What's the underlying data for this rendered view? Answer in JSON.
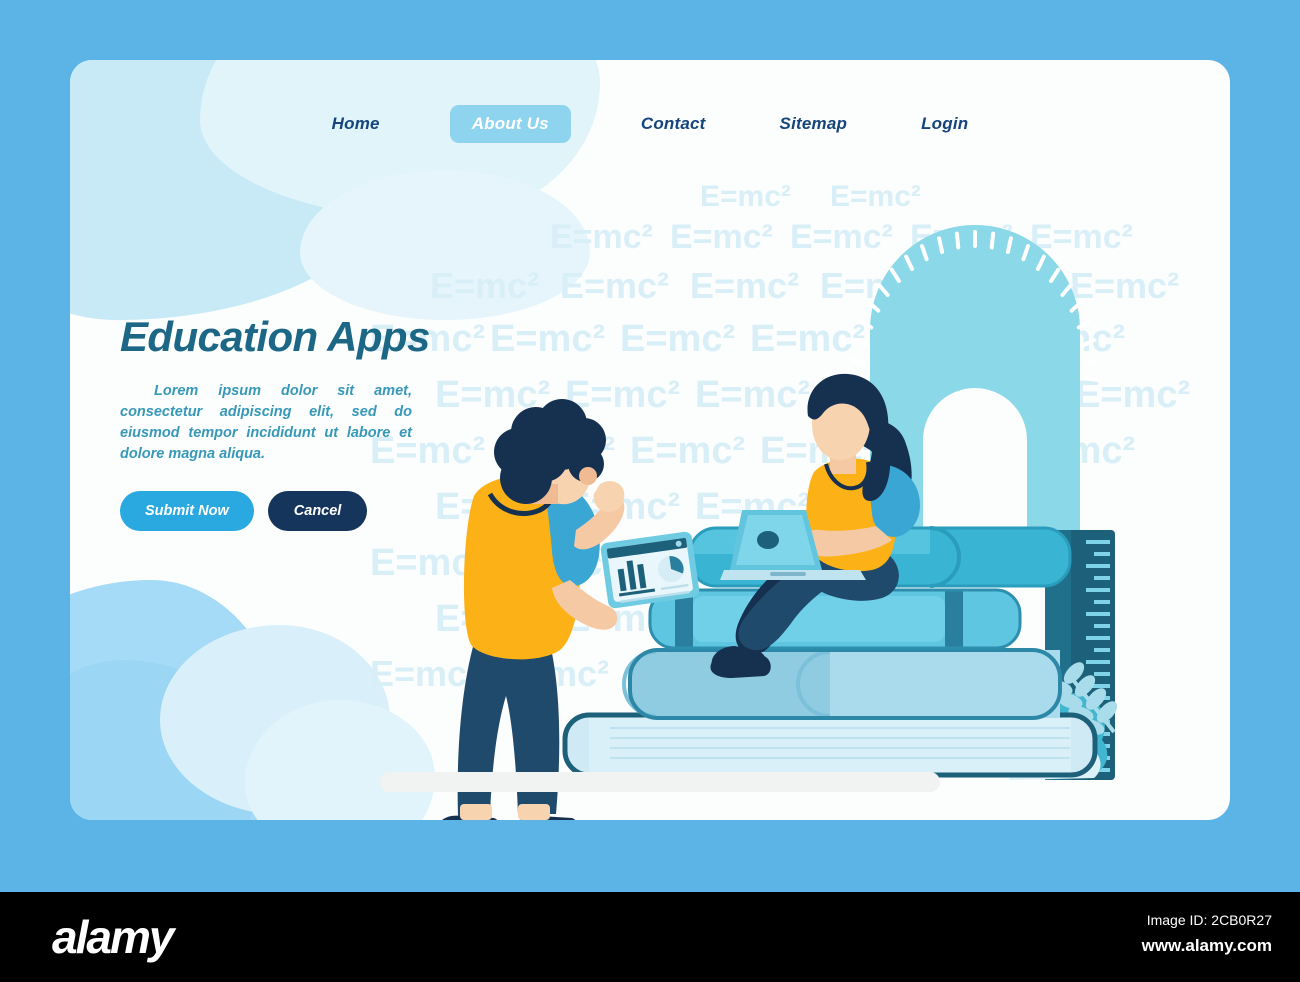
{
  "colors": {
    "page_background": "#5cb3e6",
    "card_background": "#fcfdfd",
    "nav_text": "#15457c",
    "nav_active_pill": "#8ed4ee",
    "heading": "#1c6785",
    "subtitle": "#3798b8",
    "primary_button": "#2aa8e0",
    "secondary_button": "#16355c",
    "watermark": "#d9eff8",
    "footer_background": "#000000"
  },
  "nav": {
    "items": [
      {
        "label": "Home",
        "active": false
      },
      {
        "label": "About Us",
        "active": true
      },
      {
        "label": "Contact",
        "active": false
      },
      {
        "label": "Sitemap",
        "active": false
      },
      {
        "label": "Login",
        "active": false
      }
    ]
  },
  "hero": {
    "title": "Education Apps",
    "subtitle": "Lorem ipsum dolor sit amet, consectetur adipiscing elit, sed do eiusmod tempor incididunt ut labore et dolore magna aliqua.",
    "primary_button": "Submit Now",
    "secondary_button": "Cancel"
  },
  "background_pattern": {
    "formula": "E=mc²",
    "repeat_count": 34
  },
  "illustration": {
    "description": "Two people using education apps on a stack of books, with a protractor and a ruler",
    "elements": [
      "person-standing-with-tablet",
      "woman-sitting-with-laptop",
      "book-stack",
      "protractor",
      "ruler",
      "plants"
    ]
  },
  "footer": {
    "logo": "alamy",
    "image_id": "Image ID: 2CB0R27",
    "url": "www.alamy.com"
  }
}
